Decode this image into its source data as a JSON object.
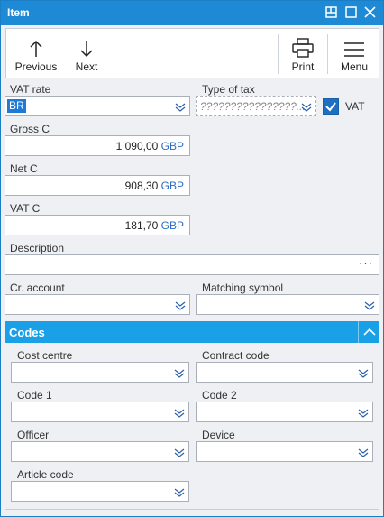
{
  "window": {
    "title": "Item"
  },
  "toolbar": {
    "previous": "Previous",
    "next": "Next",
    "print": "Print",
    "menu": "Menu"
  },
  "form": {
    "vat_rate_label": "VAT rate",
    "vat_rate_value": "BR",
    "type_of_tax_label": "Type of tax",
    "type_of_tax_placeholder": "????????????????...",
    "vat_check_label": "VAT",
    "vat_checked": true,
    "gross_label": "Gross C",
    "gross_value": "1 090,00",
    "net_label": "Net C",
    "net_value": "908,30",
    "vat_c_label": "VAT C",
    "vat_c_value": "181,70",
    "currency": "GBP",
    "description_label": "Description",
    "description_value": "",
    "cr_account_label": "Cr. account",
    "matching_symbol_label": "Matching symbol"
  },
  "codes": {
    "title": "Codes",
    "cost_centre_label": "Cost centre",
    "contract_code_label": "Contract code",
    "code1_label": "Code 1",
    "code2_label": "Code 2",
    "officer_label": "Officer",
    "device_label": "Device",
    "article_code_label": "Article code"
  },
  "icons": {
    "previous": "arrow-up-icon",
    "next": "arrow-down-icon",
    "print": "printer-icon",
    "menu": "hamburger-icon",
    "dropdown": "dropdown-icon",
    "more": "ellipsis-icon"
  },
  "colors": {
    "titlebar": "#1e8ad6",
    "section_header": "#1aa0e6",
    "selection": "#1e7ad6",
    "currency": "#2a6cc4"
  }
}
